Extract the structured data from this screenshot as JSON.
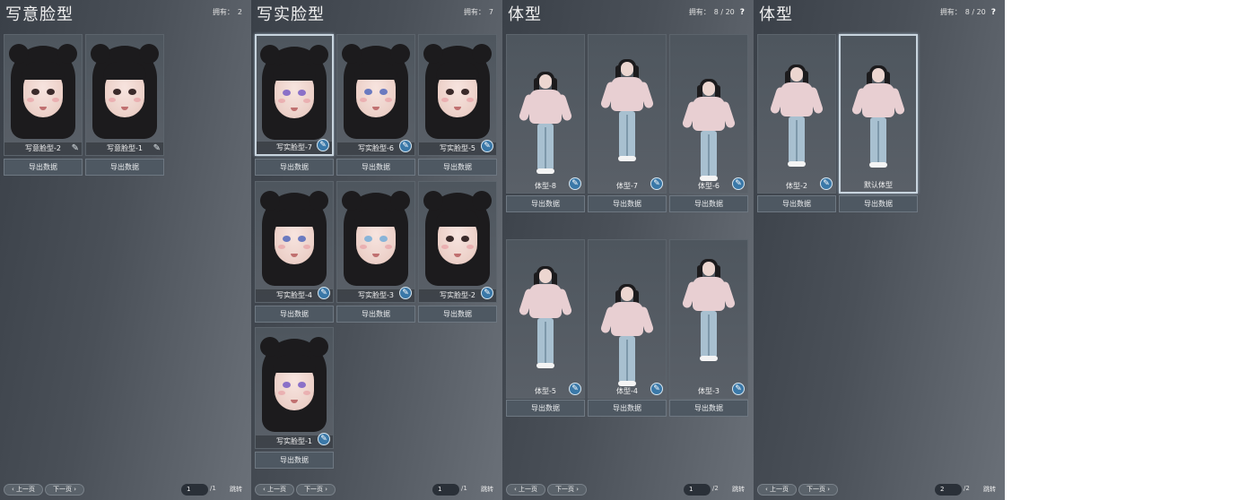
{
  "panels": [
    {
      "title": "写意脸型",
      "owned_label": "拥有：",
      "owned_value": "2",
      "help": "",
      "cards": [
        {
          "label": "写意脸型-2",
          "button": "导出数据"
        },
        {
          "label": "写意脸型-1",
          "button": "导出数据"
        }
      ],
      "pager": {
        "prev": "上一页",
        "next": "下一页",
        "page": "1",
        "total": "/1",
        "jump": "跳转"
      }
    },
    {
      "title": "写实脸型",
      "owned_label": "拥有：",
      "owned_value": "7",
      "help": "",
      "cards": [
        {
          "label": "写实脸型-7",
          "button": "导出数据"
        },
        {
          "label": "写实脸型-6",
          "button": "导出数据"
        },
        {
          "label": "写实脸型-5",
          "button": "导出数据"
        },
        {
          "label": "写实脸型-4",
          "button": "导出数据"
        },
        {
          "label": "写实脸型-3",
          "button": "导出数据"
        },
        {
          "label": "写实脸型-2",
          "button": "导出数据"
        },
        {
          "label": "写实脸型-1",
          "button": "导出数据"
        }
      ],
      "pager": {
        "prev": "上一页",
        "next": "下一页",
        "page": "1",
        "total": "/1",
        "jump": "跳转"
      }
    },
    {
      "title": "体型",
      "owned_label": "拥有：",
      "owned_value": "8 / 20",
      "help": "?",
      "cards": [
        {
          "label": "体型-8",
          "button": "导出数据"
        },
        {
          "label": "体型-7",
          "button": "导出数据"
        },
        {
          "label": "体型-6",
          "button": "导出数据"
        },
        {
          "label": "体型-5",
          "button": "导出数据"
        },
        {
          "label": "体型-4",
          "button": "导出数据"
        },
        {
          "label": "体型-3",
          "button": "导出数据"
        }
      ],
      "pager": {
        "prev": "上一页",
        "next": "下一页",
        "page": "1",
        "total": "/2",
        "jump": "跳转"
      }
    },
    {
      "title": "体型",
      "owned_label": "拥有：",
      "owned_value": "8 / 20",
      "help": "?",
      "cards": [
        {
          "label": "体型-2",
          "button": "导出数据"
        },
        {
          "label": "默认体型",
          "button": "导出数据"
        }
      ],
      "pager": {
        "prev": "上一页",
        "next": "下一页",
        "page": "2",
        "total": "/2",
        "jump": "跳转"
      }
    }
  ],
  "colors": {
    "edit_badge": "#3a78a8",
    "selected_border": "#c8d4de"
  },
  "icons": {
    "edit": "brush-icon",
    "help": "question-icon",
    "prev": "chevron-left-icon",
    "next": "chevron-right-icon"
  }
}
